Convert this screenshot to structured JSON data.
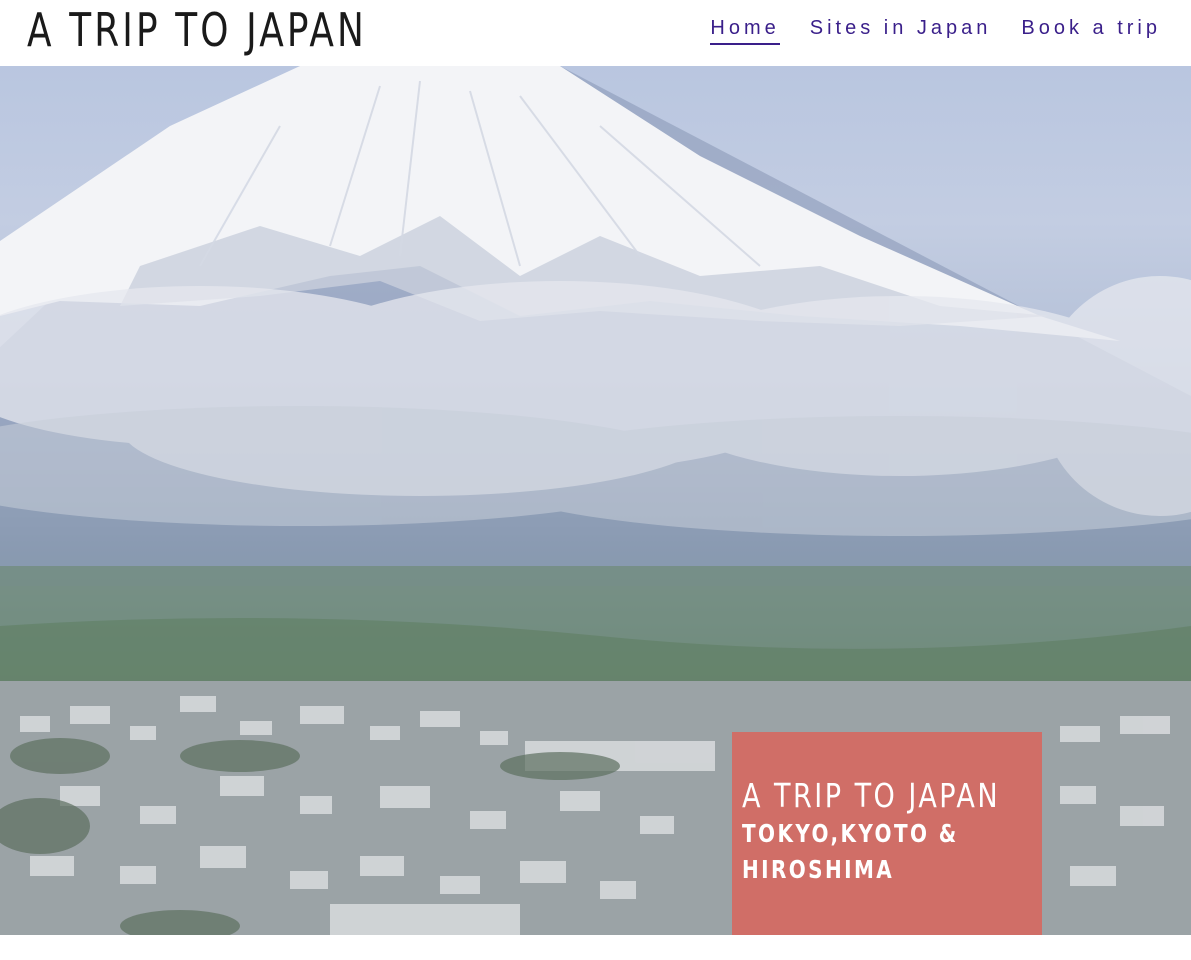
{
  "header": {
    "site_title": "A TRIP TO JAPAN",
    "nav": [
      {
        "label": "Home",
        "active": true
      },
      {
        "label": "Sites in Japan",
        "active": false
      },
      {
        "label": "Book a trip",
        "active": false
      }
    ]
  },
  "hero": {
    "overlay_title": "A TRIP TO JAPAN",
    "overlay_subtitle": "TOKYO,KYOTO & HIROSHIMA",
    "overlay_color": "#d66860"
  },
  "colors": {
    "nav_link": "#3a1f8a",
    "title": "#1a1a1a"
  }
}
